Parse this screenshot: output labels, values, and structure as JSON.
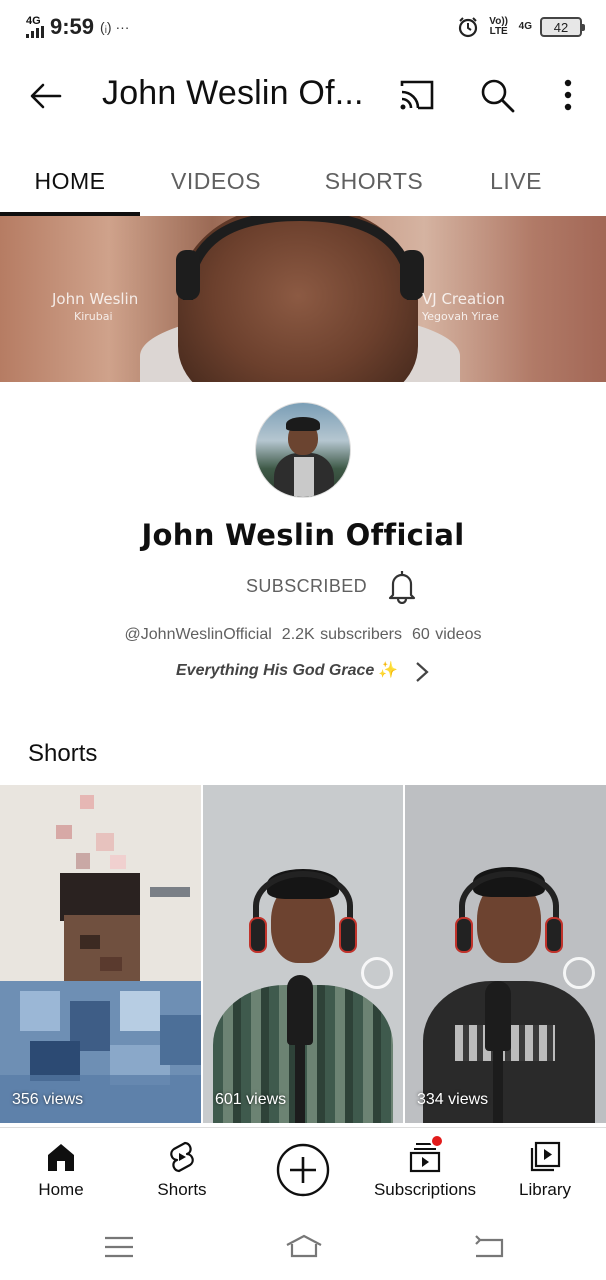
{
  "status_bar": {
    "network": "4G",
    "time": "9:59",
    "extra": "(ᵢ) ···",
    "volte": "Vo)) LTE",
    "network_right": "4G",
    "battery": "42"
  },
  "app_bar": {
    "title": "John Weslin Of..."
  },
  "tabs": [
    {
      "label": "HOME",
      "active": true
    },
    {
      "label": "VIDEOS",
      "active": false
    },
    {
      "label": "SHORTS",
      "active": false
    },
    {
      "label": "LIVE",
      "active": false
    }
  ],
  "banner": {
    "left_title": "John Weslin",
    "left_subtitle": "Kirubai",
    "right_title": "VJ Creation",
    "right_subtitle": "Yegovah Yirae"
  },
  "channel": {
    "name": "John Weslin Official",
    "subscribe_state": "SUBSCRIBED",
    "handle": "@JohnWeslinOfficial",
    "subscribers": "2.2K subscribers",
    "videos": "60 videos",
    "description": "Everything His God Grace",
    "description_emoji": "✨"
  },
  "shorts": {
    "title": "Shorts",
    "items": [
      {
        "views": "356 views"
      },
      {
        "views": "601 views"
      },
      {
        "views": "334 views"
      }
    ]
  },
  "bottom_nav": {
    "items": [
      {
        "label": "Home",
        "icon": "home-icon"
      },
      {
        "label": "Shorts",
        "icon": "shorts-icon"
      },
      {
        "label": "",
        "icon": "create-icon"
      },
      {
        "label": "Subscriptions",
        "icon": "subscriptions-icon"
      },
      {
        "label": "Library",
        "icon": "library-icon"
      }
    ]
  },
  "colors": {
    "text_primary": "#0f0f0f",
    "text_secondary": "#606060",
    "notification": "#e21b1b"
  }
}
